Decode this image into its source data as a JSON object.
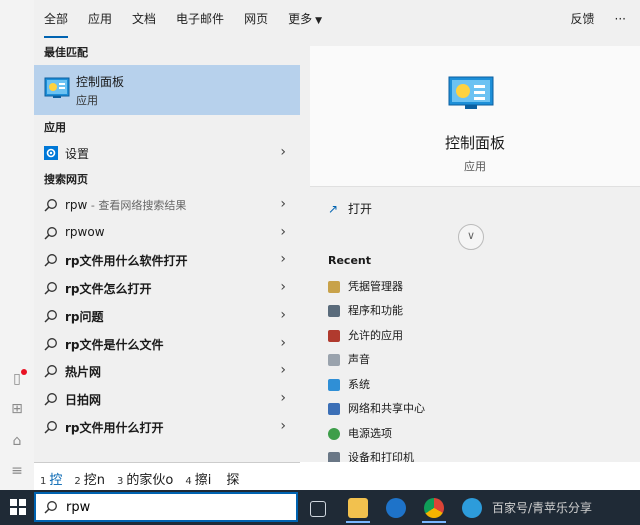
{
  "tabs": [
    {
      "label": "全部"
    },
    {
      "label": "应用"
    },
    {
      "label": "文档"
    },
    {
      "label": "电子邮件"
    },
    {
      "label": "网页"
    },
    {
      "label": "更多"
    }
  ],
  "feedback_label": "反馈",
  "more_options_label": "···",
  "best_match": {
    "section": "最佳匹配",
    "title": "控制面板",
    "subtitle": "应用"
  },
  "apps": {
    "section": "应用",
    "items": [
      {
        "label": "设置"
      }
    ]
  },
  "web": {
    "section": "搜索网页",
    "items": [
      {
        "text": "rpw",
        "suffix": " - 查看网络搜索结果"
      },
      {
        "text": "rpwow"
      },
      {
        "text": "rp文件用什么软件打开"
      },
      {
        "text": "rp文件怎么打开"
      },
      {
        "text": "rp问题"
      },
      {
        "text": "rp文件是什么文件"
      },
      {
        "text": "热片网"
      },
      {
        "text": "日拍网"
      },
      {
        "text": "rp文件用什么打开"
      }
    ]
  },
  "preview": {
    "title": "控制面板",
    "subtitle": "应用",
    "open_label": "打开",
    "recent_title": "Recent",
    "recent": [
      {
        "label": "凭据管理器"
      },
      {
        "label": "程序和功能"
      },
      {
        "label": "允许的应用"
      },
      {
        "label": "声音"
      },
      {
        "label": "系统"
      },
      {
        "label": "网络和共享中心"
      },
      {
        "label": "电源选项"
      },
      {
        "label": "设备和打印机"
      }
    ]
  },
  "ime": {
    "candidates": [
      {
        "n": "1",
        "text": "控"
      },
      {
        "n": "2",
        "text": "挖n"
      },
      {
        "n": "3",
        "text": "的家伙o"
      },
      {
        "n": "4",
        "text": "擦i"
      },
      {
        "n": "",
        "text": "探"
      }
    ]
  },
  "search": {
    "query": "rpw"
  },
  "watermark": "百家号/青苹乐分享",
  "colors": {
    "accent": "#0063b1",
    "selected": "#b7d1ec",
    "taskbar": "#1f2a36"
  }
}
